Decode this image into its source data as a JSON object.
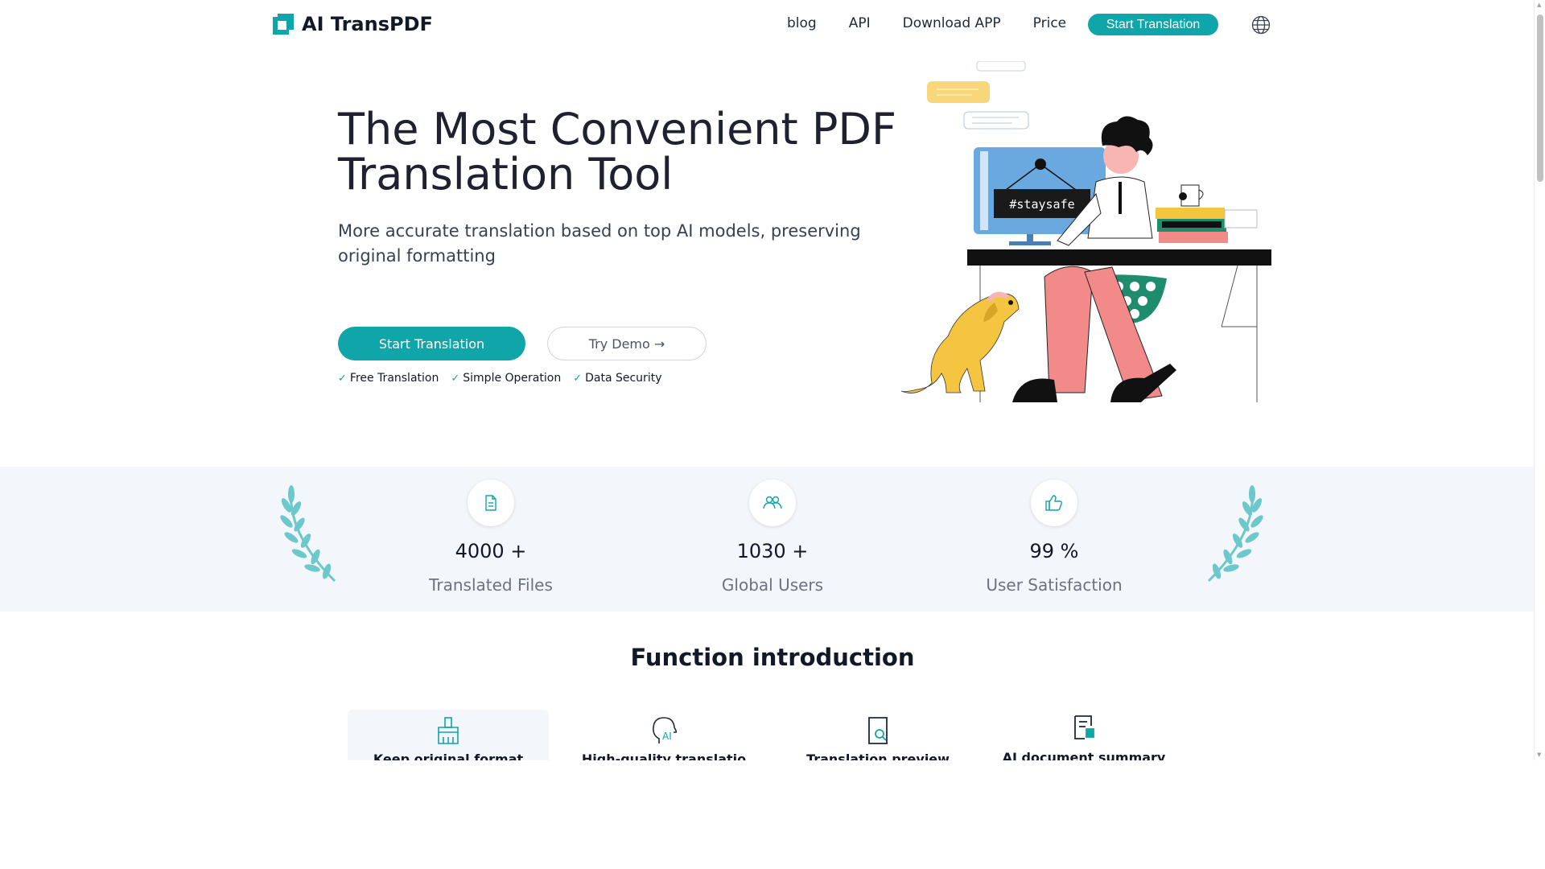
{
  "brand": {
    "name": "AI TransPDF",
    "accent": "#0fa5a9"
  },
  "nav": {
    "links": [
      "blog",
      "API",
      "Download APP",
      "Price"
    ],
    "cta": "Start Translation",
    "language_icon": "globe-icon"
  },
  "hero": {
    "title": "The Most Convenient PDF Translation Tool",
    "subtitle": "More accurate translation based on top AI models, preserving original formatting",
    "primary_button": "Start Translation",
    "secondary_button": "Try Demo →",
    "features": [
      "Free Translation",
      "Simple Operation",
      "Data Security"
    ],
    "illustration_text": "#staysafe"
  },
  "stats": [
    {
      "icon": "document-icon",
      "value": "4000 +",
      "label": "Translated Files"
    },
    {
      "icon": "users-icon",
      "value": "1030 +",
      "label": "Global Users"
    },
    {
      "icon": "thumbs-up-icon",
      "value": "99 %",
      "label": "User Satisfaction"
    }
  ],
  "functions": {
    "title": "Function introduction",
    "tabs": [
      {
        "icon": "brush-icon",
        "label": "Keep original format"
      },
      {
        "icon": "ai-head-icon",
        "label": "High-quality translatio"
      },
      {
        "icon": "preview-icon",
        "label": "Translation preview"
      },
      {
        "icon": "summary-icon",
        "label": "AI document summary"
      }
    ]
  }
}
